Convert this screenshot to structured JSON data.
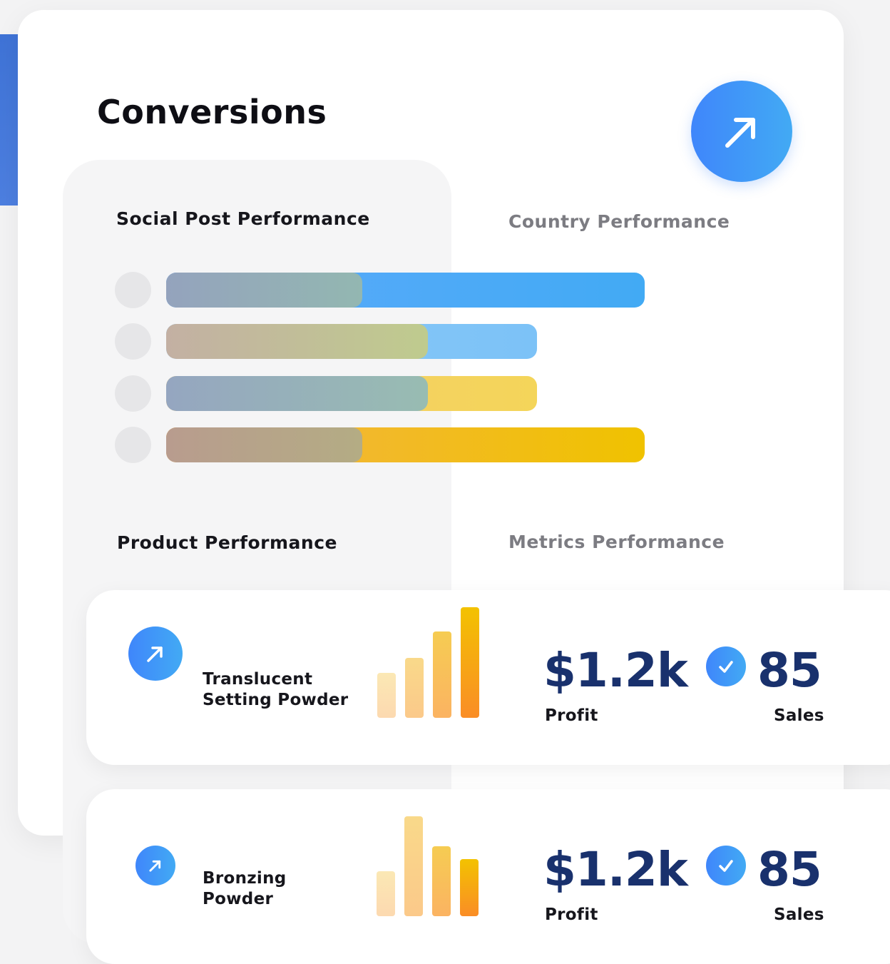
{
  "title": "Conversions",
  "sections": {
    "social": "Social Post Performance",
    "country": "Country Performance",
    "product": "Product  Performance",
    "metrics": "Metrics Performance"
  },
  "icons": {
    "arrow": "arrow-up-right-icon",
    "check": "check-circle-icon"
  },
  "colors": {
    "accent_start": "#3f86fb",
    "accent_end": "#42aaf4",
    "value": "#19316d"
  },
  "products": [
    {
      "name_line1": "Translucent",
      "name_line2": "Setting Powder",
      "profit": "$1.2k",
      "profit_label": "Profit",
      "sales": "85",
      "sales_label": "Sales"
    },
    {
      "name_line1": "Bronzing",
      "name_line2": "Powder",
      "profit": "$1.2k",
      "profit_label": "Profit",
      "sales": "85",
      "sales_label": "Sales"
    }
  ]
}
